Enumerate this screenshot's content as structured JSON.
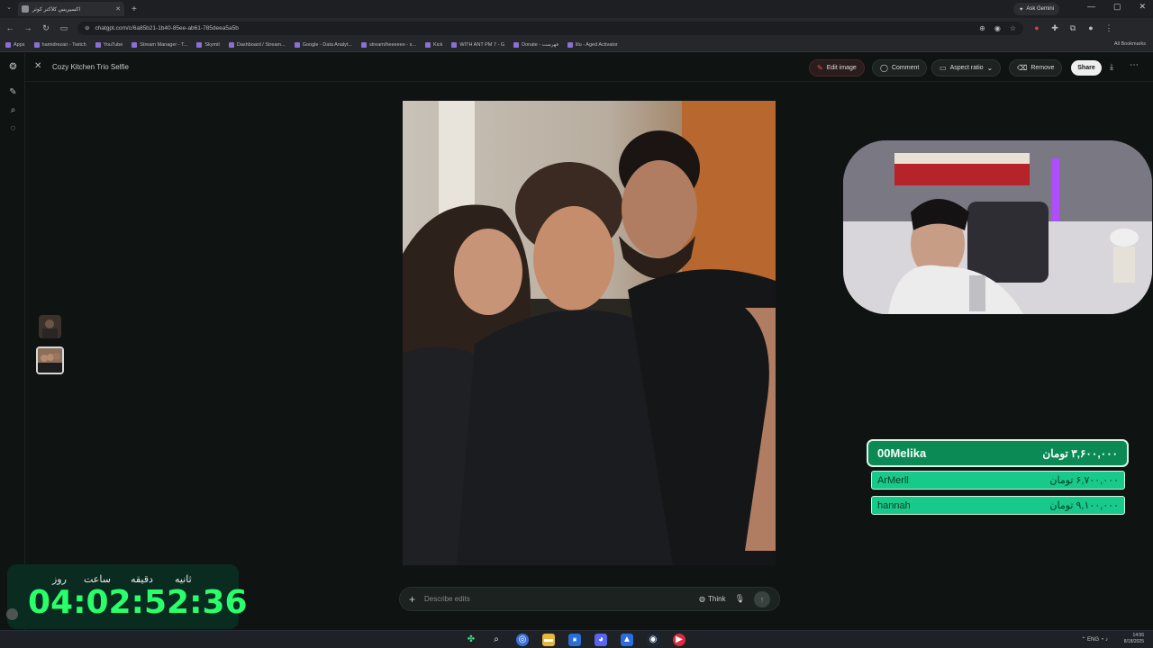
{
  "browser": {
    "tab_title": "اکسپریس کلاکتر کوثر",
    "new_tab_symbol": "+",
    "gemini_label": "Ask Gemini",
    "url": "chatgpt.com/c/6a85b21-1b40-85ee-ab61-785deea5a5b",
    "bookmarks": [
      "Apps",
      "hamidrezair - Twitch",
      "YouTube",
      "Stream Manager - T...",
      "Skymit",
      "Dashboard / Stream...",
      "Google - Data Analyt...",
      "stream/heeeeee - s...",
      "Kick",
      "WITH ANT PM 7 - G",
      "Donate - فهرست",
      "lilu - Aged Activator"
    ],
    "all_bookmarks": "All Bookmarks"
  },
  "app": {
    "doc_title": "Cozy Kitchen Trio Selfie",
    "toolbar": {
      "edit_image": "Edit image",
      "comment": "Comment",
      "aspect_ratio": "Aspect ratio",
      "remove": "Remove",
      "share": "Share"
    },
    "composer": {
      "placeholder": "Describe edits",
      "think": "Think"
    }
  },
  "leaderboard": {
    "top": {
      "name": "00Melika",
      "amount": "۳,۶۰۰,۰۰۰ تومان"
    },
    "rows": [
      {
        "name": "ArMerll",
        "amount": "۶,۷۰۰,۰۰۰ تومان"
      },
      {
        "name": "hannah",
        "amount": "۹,۱۰۰,۰۰۰ تومان"
      }
    ]
  },
  "countdown": {
    "labels": {
      "day": "روز",
      "hour": "ساعت",
      "minute": "دقیقه",
      "second": "ثانیه"
    },
    "value": "04:02:52:36"
  },
  "taskbar": {
    "time": "14:56",
    "date": "8/18/2025",
    "lang": "ENG"
  },
  "colors": {
    "accent_green": "#29ff6b",
    "donation_green": "#17c98a",
    "edit_red": "#ff4d4d"
  }
}
